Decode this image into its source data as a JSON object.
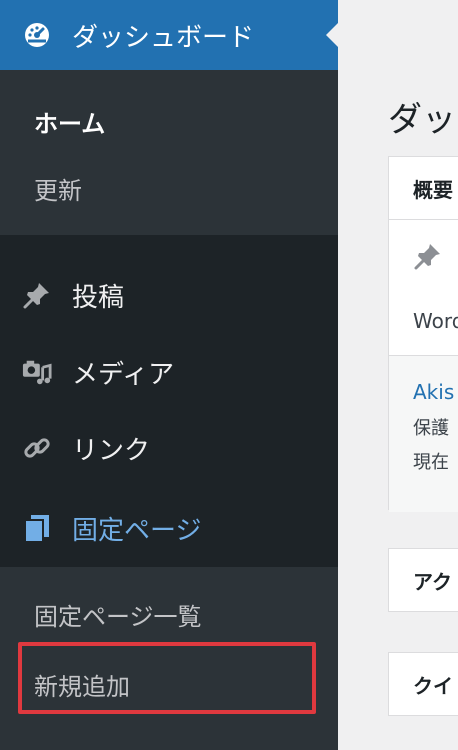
{
  "sidebar": {
    "dashboard_label": "ダッシュボード",
    "dashboard_sub": {
      "home": "ホーム",
      "updates": "更新"
    },
    "posts_label": "投稿",
    "media_label": "メディア",
    "links_label": "リンク",
    "pages_label": "固定ページ",
    "pages_sub": {
      "all_pages": "固定ページ一覧",
      "add_new": "新規追加"
    }
  },
  "main": {
    "page_title": "ダッ",
    "overview_box": {
      "title": "概要",
      "line1": "Word",
      "link": "Akis",
      "line2": "保護",
      "line3": "現在"
    },
    "activity_box": {
      "title": "アク"
    },
    "quickdraft_box": {
      "title": "クイ"
    }
  },
  "colors": {
    "sidebar_bg": "#1d2327",
    "submenu_bg": "#2c3338",
    "accent": "#2271b1",
    "active_text": "#72aee6",
    "highlight_border": "#e0393f"
  }
}
